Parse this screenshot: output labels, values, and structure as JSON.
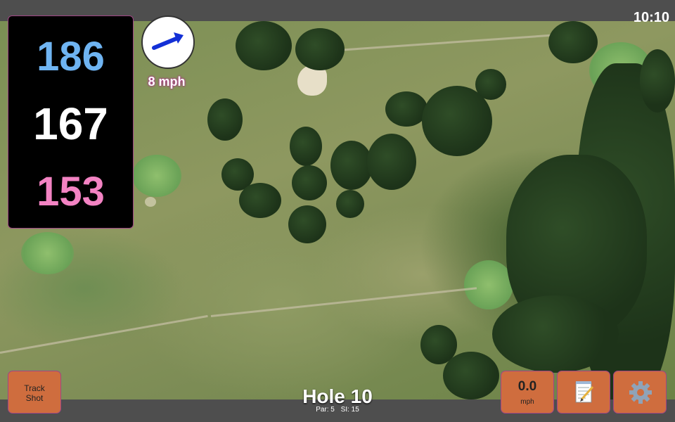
{
  "status": {
    "time": "10:10"
  },
  "distances": {
    "back": "186",
    "center": "167",
    "front": "153"
  },
  "wind": {
    "speed": "8 mph",
    "direction_icon": "wind-arrow-icon"
  },
  "hole": {
    "title": "Hole 10",
    "par": "Par: 5",
    "stroke_index": "SI: 15"
  },
  "buttons": {
    "track_shot": "Track Shot",
    "speed_value": "0.0",
    "speed_unit": "mph",
    "notes_icon": "notepad-icon",
    "settings_icon": "gear-icon"
  },
  "colors": {
    "back_distance": "#6fb4f2",
    "center_distance": "#ffffff",
    "front_distance": "#f383c3",
    "button": "#cf6d3e",
    "accent_border": "#a04585"
  }
}
